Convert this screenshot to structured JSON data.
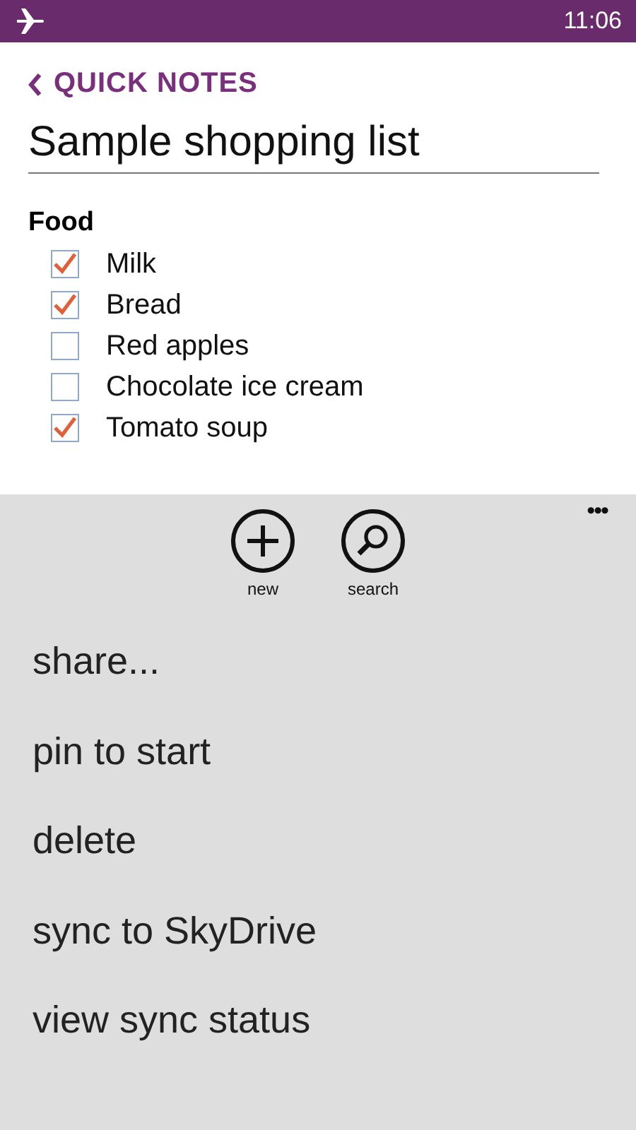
{
  "status_bar": {
    "time": "11:06"
  },
  "header": {
    "back_label": "QUICK NOTES",
    "title": "Sample shopping list"
  },
  "sections": [
    {
      "heading": "Food",
      "items": [
        {
          "label": "Milk",
          "checked": true
        },
        {
          "label": "Bread",
          "checked": true
        },
        {
          "label": "Red apples",
          "checked": false
        },
        {
          "label": "Chocolate ice cream",
          "checked": false
        },
        {
          "label": "Tomato soup",
          "checked": true
        }
      ]
    }
  ],
  "app_bar": {
    "more": "•••",
    "buttons": [
      {
        "kind": "new",
        "label": "new"
      },
      {
        "kind": "search",
        "label": "search"
      }
    ],
    "menu": [
      "share...",
      "pin to start",
      "delete",
      "sync to SkyDrive",
      "view sync status"
    ]
  }
}
